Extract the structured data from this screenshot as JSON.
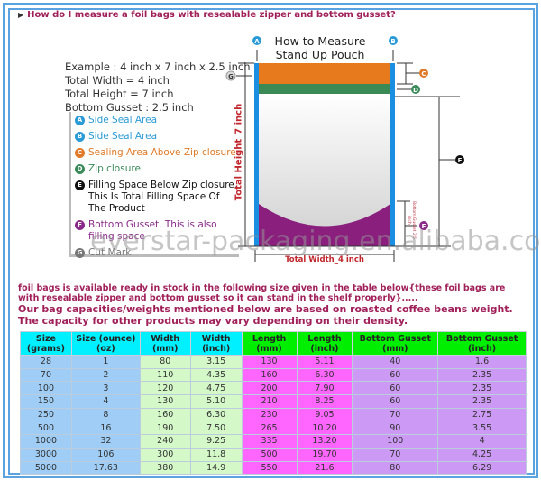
{
  "header": "How do I measure a foil bags with resealable zipper and bottom gusset?",
  "diagram": {
    "title_lines": [
      "How to Measure",
      "Stand Up Pouch"
    ],
    "example_lines": [
      "Example : 4 inch x 7 inch x 2.5 inch",
      "Total Width = 4 inch",
      "Total Height = 7 inch",
      "Bottom Gusset : 2.5 inch"
    ],
    "legend": [
      {
        "mark": "A",
        "text": "Side Seal Area",
        "color": "#2a9ad6"
      },
      {
        "mark": "B",
        "text": "Side Seal Area",
        "color": "#2a9ad6"
      },
      {
        "mark": "C",
        "text": "Sealing Area Above Zip closure",
        "color": "#e07a28"
      },
      {
        "mark": "D",
        "text": "Zip closure",
        "color": "#3a8a5a"
      },
      {
        "mark": "E",
        "text": "Filling Space Below Zip closure. This Is Total Filling Space Of The Product",
        "color": "#111111"
      },
      {
        "mark": "F",
        "text": "Bottom Gusset. This is also filling space",
        "color": "#8a2a8a"
      },
      {
        "mark": "G",
        "text": "Cut Mark",
        "color": "#777777"
      }
    ],
    "height_label": "Total Height_7 inch",
    "width_label": "Total Width_4 inch",
    "gusset_label": "Bottom Gusset 2.5 inch",
    "watermark": "everstar-packaging.en.alibaba.com"
  },
  "intro": "foil bags is available ready in stock in the following size given in the table below{these foil bags are with resealable zipper and bottom gusset so it can stand in the shelf properly}.....",
  "note": "Our bag capacities/weights mentioned below are based on roasted coffee beans weight. The capacity for other products may vary depending on their density.",
  "table": {
    "headers": [
      [
        "Size",
        "(grams)"
      ],
      [
        "Size (ounce)",
        "(oz)"
      ],
      [
        "Width",
        "(mm)"
      ],
      [
        "Width",
        "(inch)"
      ],
      [
        "Length",
        "(mm)"
      ],
      [
        "Length",
        "(inch)"
      ],
      [
        "Bottom Gusset",
        "(mm)"
      ],
      [
        "Bottom Gusset",
        "(inch)"
      ]
    ],
    "rows": [
      [
        "28",
        "1",
        "80",
        "3.15",
        "130",
        "5.11",
        "40",
        "1.6"
      ],
      [
        "70",
        "2",
        "110",
        "4.35",
        "160",
        "6.30",
        "60",
        "2.35"
      ],
      [
        "100",
        "3",
        "120",
        "4.75",
        "200",
        "7.90",
        "60",
        "2.35"
      ],
      [
        "150",
        "4",
        "130",
        "5.10",
        "210",
        "8.25",
        "60",
        "2.35"
      ],
      [
        "250",
        "8",
        "160",
        "6.30",
        "230",
        "9.05",
        "70",
        "2.75"
      ],
      [
        "500",
        "16",
        "190",
        "7.50",
        "265",
        "10.20",
        "90",
        "3.55"
      ],
      [
        "1000",
        "32",
        "240",
        "9.25",
        "335",
        "13.20",
        "100",
        "4"
      ],
      [
        "3000",
        "106",
        "300",
        "11.8",
        "500",
        "19.70",
        "70",
        "4.25"
      ],
      [
        "5000",
        "17.63",
        "380",
        "14.9",
        "550",
        "21.6",
        "80",
        "6.29"
      ]
    ]
  }
}
